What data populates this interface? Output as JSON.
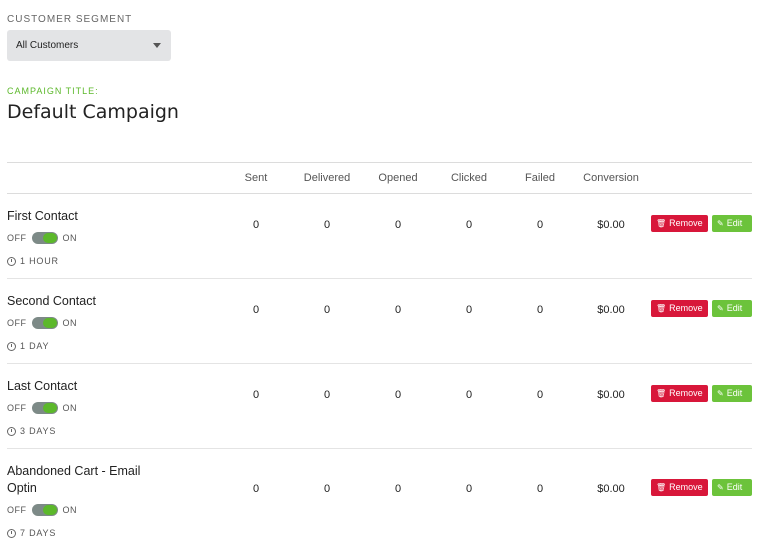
{
  "segment": {
    "label": "CUSTOMER SEGMENT",
    "selected": "All Customers"
  },
  "campaign": {
    "label": "CAMPAIGN TITLE:",
    "title": "Default Campaign"
  },
  "columns": [
    "Sent",
    "Delivered",
    "Opened",
    "Clicked",
    "Failed",
    "Conversion"
  ],
  "toggle_labels": {
    "off": "OFF",
    "on": "ON"
  },
  "actions": {
    "remove": "Remove",
    "edit": "Edit"
  },
  "icons": {
    "remove": "trash-icon",
    "edit": "pencil-icon",
    "delay": "clock-icon",
    "select": "caret-down-icon"
  },
  "colors": {
    "accent_green": "#5cb82b",
    "remove_red": "#d8173a",
    "edit_green": "#6cc33b"
  },
  "rows": [
    {
      "name": "First Contact",
      "enabled": true,
      "delay": "1 HOUR",
      "sent": "0",
      "delivered": "0",
      "opened": "0",
      "clicked": "0",
      "failed": "0",
      "conversion": "$0.00"
    },
    {
      "name": "Second Contact",
      "enabled": true,
      "delay": "1 DAY",
      "sent": "0",
      "delivered": "0",
      "opened": "0",
      "clicked": "0",
      "failed": "0",
      "conversion": "$0.00"
    },
    {
      "name": "Last Contact",
      "enabled": true,
      "delay": "3 DAYS",
      "sent": "0",
      "delivered": "0",
      "opened": "0",
      "clicked": "0",
      "failed": "0",
      "conversion": "$0.00"
    },
    {
      "name": "Abandoned Cart - Email Optin",
      "enabled": true,
      "delay": "7 DAYS",
      "sent": "0",
      "delivered": "0",
      "opened": "0",
      "clicked": "0",
      "failed": "0",
      "conversion": "$0.00"
    }
  ]
}
